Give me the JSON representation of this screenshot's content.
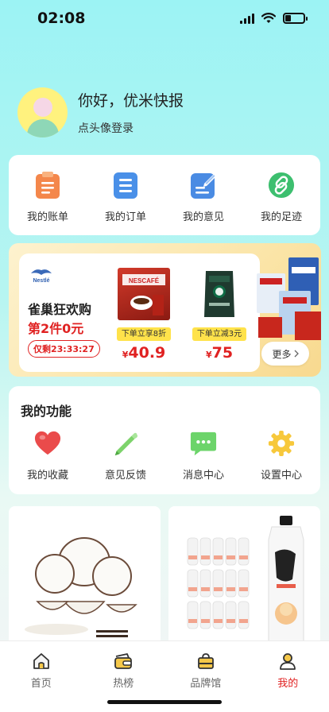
{
  "status_bar": {
    "time": "02:08",
    "battery_percent": 30
  },
  "profile": {
    "greeting": "你好，优米快报",
    "login_hint": "点头像登录"
  },
  "account_menu": [
    {
      "label": "我的账单",
      "icon": "bill-icon",
      "color": "#f4874b"
    },
    {
      "label": "我的订单",
      "icon": "order-icon",
      "color": "#4a90e8"
    },
    {
      "label": "我的意见",
      "icon": "edit-icon",
      "color": "#4a8be3"
    },
    {
      "label": "我的足迹",
      "icon": "link-icon",
      "color": "#3dbf6f"
    }
  ],
  "promo": {
    "brand": "雀巢 Nestlé",
    "title": "雀巢狂欢购",
    "subtitle": "第2件0元",
    "countdown": "仅剩23:33:27",
    "products": [
      {
        "name": "NESCAFE",
        "tag": "下单立享8折",
        "currency": "¥",
        "price": "40.9"
      },
      {
        "name": "STARBUCKS ESPRESSO",
        "tag": "下单立减3元",
        "currency": "¥",
        "price": "75"
      }
    ],
    "more_label": "更多",
    "colors": {
      "red": "#e02222",
      "tag_yellow": "#ffe24a"
    }
  },
  "features": {
    "title": "我的功能",
    "items": [
      {
        "label": "我的收藏",
        "icon": "heart-icon",
        "color": "#ea4b4b"
      },
      {
        "label": "意见反馈",
        "icon": "pencil-icon",
        "color": "#7dd36b"
      },
      {
        "label": "消息中心",
        "icon": "chat-icon",
        "color": "#6cd46a"
      },
      {
        "label": "设置中心",
        "icon": "gear-icon",
        "color": "#f7c83b"
      }
    ]
  },
  "tabbar": {
    "active_index": 3,
    "tabs": [
      {
        "label": "首页",
        "icon": "home-icon"
      },
      {
        "label": "热榜",
        "icon": "wallet-icon"
      },
      {
        "label": "品牌馆",
        "icon": "shopping-bag-icon"
      },
      {
        "label": "我的",
        "icon": "user-icon"
      }
    ]
  }
}
